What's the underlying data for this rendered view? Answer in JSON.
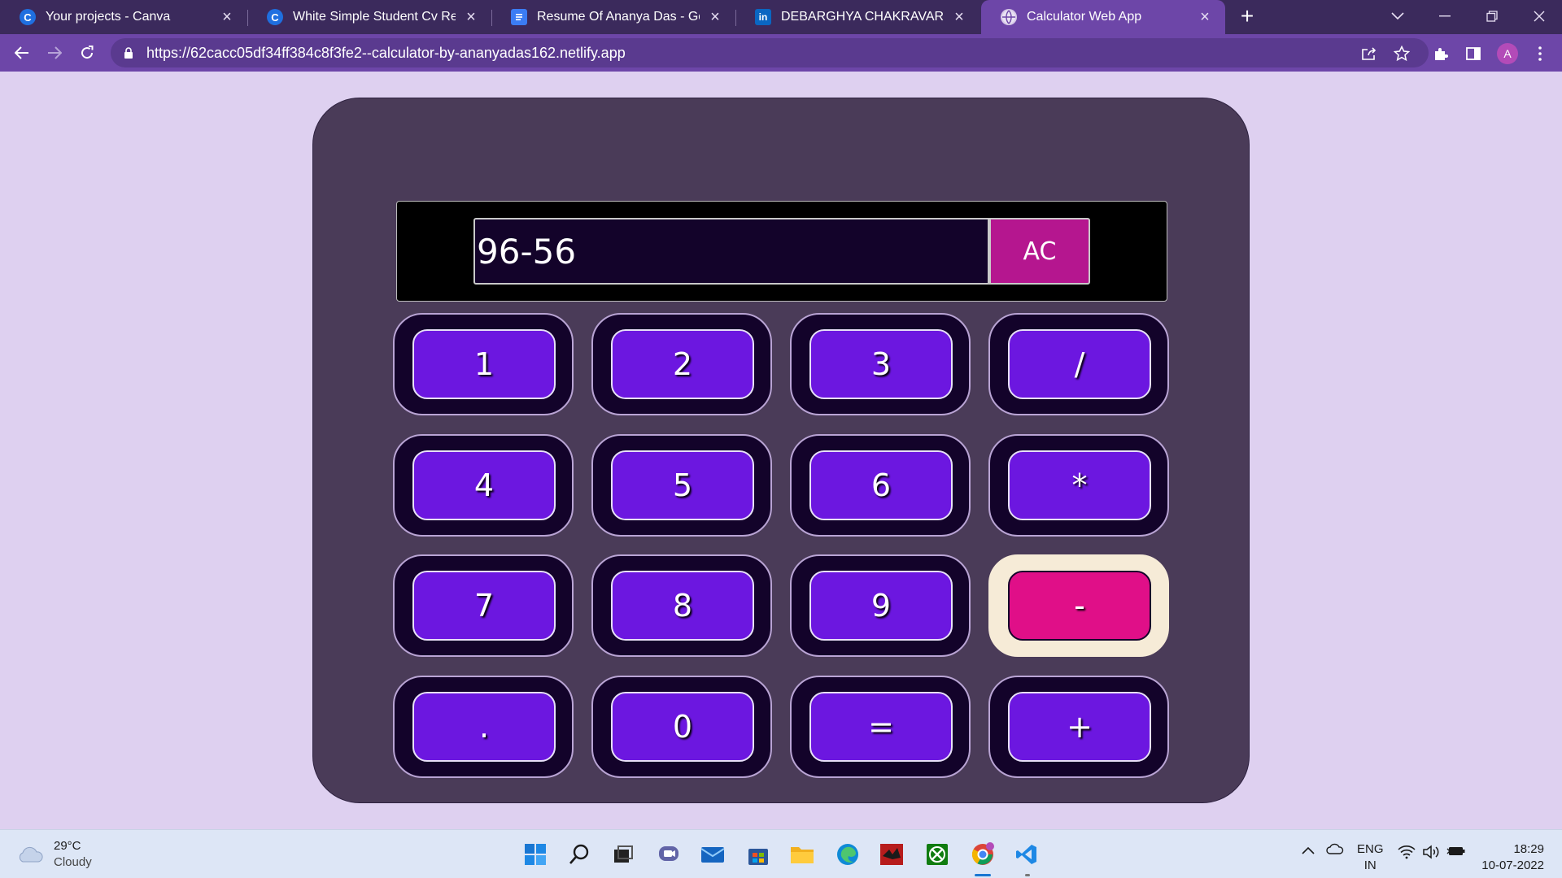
{
  "browser": {
    "tabs": [
      {
        "title": "Your projects - Canva",
        "icon": "canva-icon",
        "active": false
      },
      {
        "title": "White Simple Student Cv Resume",
        "icon": "canva-icon",
        "active": false
      },
      {
        "title": "Resume Of Ananya Das - Google",
        "icon": "google-docs-icon",
        "active": false
      },
      {
        "title": "DEBARGHYA CHAKRAVARTY | Lin",
        "icon": "linkedin-icon",
        "active": false
      },
      {
        "title": "Calculator Web App",
        "icon": "globe-icon",
        "active": true
      }
    ],
    "new_tab": "+",
    "url": "https://62cacc05df34ff384c8f3fe2--calculator-by-ananyadas162.netlify.app",
    "profile_initial": "A"
  },
  "calculator": {
    "display": "96-56",
    "clear_label": "AC",
    "keys": [
      [
        "1",
        "2",
        "3",
        "/"
      ],
      [
        "4",
        "5",
        "6",
        "*"
      ],
      [
        "7",
        "8",
        "9",
        "-"
      ],
      [
        ".",
        "0",
        "=",
        "+"
      ]
    ],
    "active_key": "-"
  },
  "taskbar": {
    "weather": {
      "temp": "29°C",
      "condition": "Cloudy"
    },
    "language": {
      "line1": "ENG",
      "line2": "IN"
    },
    "clock": {
      "time": "18:29",
      "date": "10-07-2022"
    }
  },
  "colors": {
    "page_bg": "#ded0f0",
    "calculator_body": "#4a3b58",
    "key": "#6c17e0",
    "key_active": "#e00f88",
    "clear_button": "#b5168f",
    "browser_frame": "#3b2a5c",
    "browser_toolbar": "#6d46a8"
  }
}
